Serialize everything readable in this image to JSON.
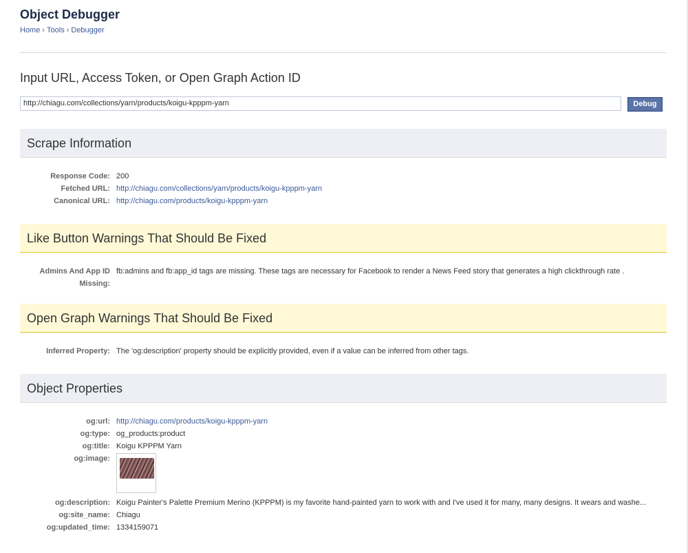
{
  "header": {
    "title": "Object Debugger",
    "breadcrumb": [
      {
        "label": "Home"
      },
      {
        "label": "Tools"
      },
      {
        "label": "Debugger"
      }
    ],
    "separator": "›"
  },
  "form": {
    "label": "Input URL, Access Token, or Open Graph Action ID",
    "url_value": "http://chiagu.com/collections/yarn/products/koigu-kpppm-yarn",
    "debug_button": "Debug"
  },
  "scrape": {
    "title": "Scrape Information",
    "rows": [
      {
        "key": "Response Code:",
        "value": "200"
      },
      {
        "key": "Fetched URL:",
        "value": "http://chiagu.com/collections/yarn/products/koigu-kpppm-yarn"
      },
      {
        "key": "Canonical URL:",
        "value": "http://chiagu.com/products/koigu-kpppm-yarn"
      }
    ]
  },
  "like_warnings": {
    "title": "Like Button Warnings That Should Be Fixed",
    "rows": [
      {
        "key": "Admins And App ID Missing:",
        "value": "fb:admins and fb:app_id tags are missing. These tags are necessary for Facebook to render a News Feed story that generates a high clickthrough rate ."
      }
    ]
  },
  "og_warnings": {
    "title": "Open Graph Warnings That Should Be Fixed",
    "rows": [
      {
        "key": "Inferred Property:",
        "value": "The 'og:description' property should be explicitly provided, even if a value can be inferred from other tags."
      }
    ]
  },
  "object_properties": {
    "title": "Object Properties",
    "url": {
      "key": "og:url:",
      "value": "http://chiagu.com/products/koigu-kpppm-yarn"
    },
    "type": {
      "key": "og:type:",
      "value": "og_products:product"
    },
    "title_prop": {
      "key": "og:title:",
      "value": "Koigu KPPPM Yarn"
    },
    "image": {
      "key": "og:image:"
    },
    "description": {
      "key": "og:description:",
      "value": "Koigu Painter's Palette Premium Merino (KPPPM) is my favorite hand-painted yarn to work with and I've used it for many, many designs. It wears and washe..."
    },
    "site_name": {
      "key": "og:site_name:",
      "value": "Chiagu"
    },
    "updated_time": {
      "key": "og:updated_time:",
      "value": "1334159071"
    }
  },
  "colors": {
    "link": "#3b5998",
    "section_gray": "#edeff4",
    "section_yellow": "#fff9d7",
    "button": "#5b74a8"
  }
}
